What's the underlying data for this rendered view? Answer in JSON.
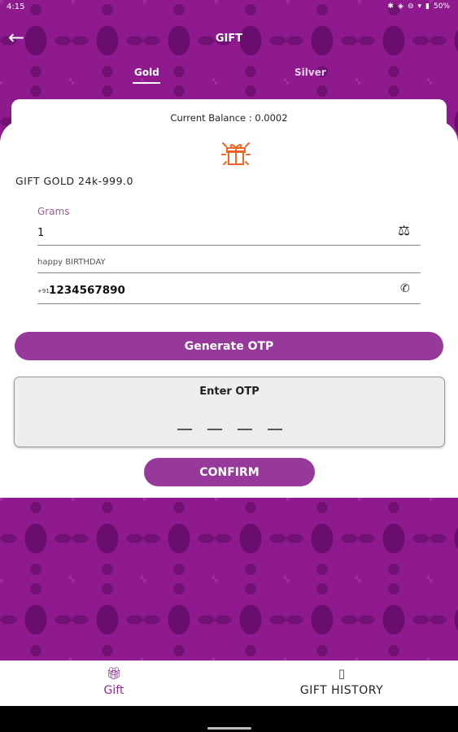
{
  "status_bar": {
    "time": "4:15",
    "battery": "50%"
  },
  "app_bar": {
    "title": "GIFT",
    "back_icon": "arrow-left-icon"
  },
  "tabs": [
    {
      "label": "Gold",
      "selected": true
    },
    {
      "label": "Silver",
      "selected": false
    }
  ],
  "card": {
    "balance": "Current Balance : 0.0002",
    "gift_heading": "GIFT GOLD 24k-999.0",
    "grams": {
      "label": "Grams",
      "value": "1"
    },
    "message": {
      "value": "happy BIRTHDAY"
    },
    "phone": {
      "prefix": "+91",
      "value": "1234567890"
    },
    "generate_otp_label": "Generate OTP",
    "otp": {
      "title": "Enter OTP"
    },
    "confirm_label": "CONFIRM"
  },
  "bottom_nav": [
    {
      "label": "Gift",
      "icon": "gift-icon",
      "active": true
    },
    {
      "label": "GIFT HISTORY",
      "icon": "history-icon",
      "active": false
    }
  ],
  "colors": {
    "accent": "#97399b",
    "background_pattern": "#8e1a8e",
    "gift_icon": "#f26522"
  }
}
